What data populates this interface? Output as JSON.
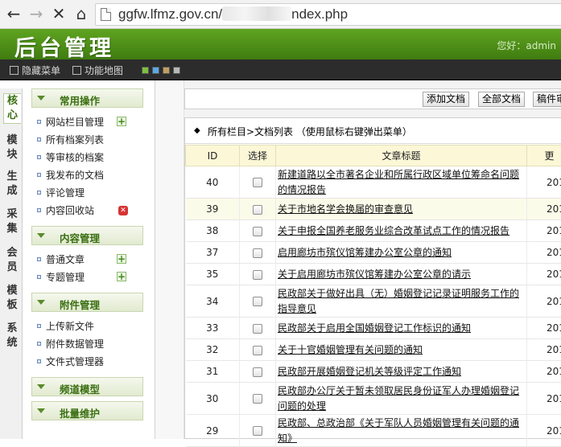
{
  "browser": {
    "url_prefix": "ggfw.lfmz.gov.cn/",
    "url_suffix": "ndex.php"
  },
  "header": {
    "logo": "后台管理",
    "welcome": "您好：admin"
  },
  "menubar": {
    "hide_menu": "隐藏菜单",
    "function_map": "功能地图",
    "swatch_colors": [
      "#7fbf3f",
      "#5aa9e6",
      "#c0a060",
      "#b8b8b8"
    ]
  },
  "sidetabs": [
    "核心",
    "模块",
    "生成",
    "采集",
    "会员",
    "模板",
    "系统"
  ],
  "leftmenu": {
    "groups": [
      {
        "title": "常用操作",
        "items": [
          "网站栏目管理",
          "所有档案列表",
          "等审核的档案",
          "我发布的文档",
          "评论管理",
          "内容回收站"
        ]
      },
      {
        "title": "内容管理",
        "items": [
          "普通文章",
          "专题管理"
        ]
      },
      {
        "title": "附件管理",
        "items": [
          "上传新文件",
          "附件数据管理",
          "文件式管理器"
        ]
      },
      {
        "title": "频道模型",
        "items": []
      },
      {
        "title": "批量维护",
        "items": []
      }
    ]
  },
  "toolbar": {
    "add_doc": "添加文档",
    "all_docs": "全部文档",
    "draft": "稿件审"
  },
  "list": {
    "heading": "所有栏目>文档列表 （使用鼠标右键弹出菜单）",
    "columns": {
      "id": "ID",
      "select": "选择",
      "title": "文章标题",
      "updated": "更"
    },
    "rows": [
      {
        "id": "40",
        "title": "新建道路以全市著名企业和所属行政区域单位筹命名问题的情况报告",
        "date": "201"
      },
      {
        "id": "39",
        "title": "关于市地名学会换届的审查意见",
        "date": "201"
      },
      {
        "id": "38",
        "title": "关于申报全国养老服务业综合改革试点工作的情况报告",
        "date": "201"
      },
      {
        "id": "37",
        "title": "启用廊坊市殡仪馆筹建办公室公章的通知",
        "date": "201"
      },
      {
        "id": "35",
        "title": "关于启用廊坊市殡仪馆筹建办公室公章的请示",
        "date": "201"
      },
      {
        "id": "34",
        "title": "民政部关于做好出具（无）婚姻登记记录证明服务工作的指导意见",
        "date": "201"
      },
      {
        "id": "33",
        "title": "民政部关于启用全国婚姻登记工作标识的通知",
        "date": "201"
      },
      {
        "id": "32",
        "title": "关于十官婚姻管理有关问题的通知",
        "date": "201"
      },
      {
        "id": "31",
        "title": "民政部开展婚姻登记机关等级评定工作通知",
        "date": "201"
      },
      {
        "id": "30",
        "title": "民政部办公厅关于暂未领取居民身份证军人办理婚姻登记问题的处理",
        "date": "201"
      },
      {
        "id": "29",
        "title": "民政部、总政治部《关于军队人员婚姻管理有关问题的通知》",
        "date": "201"
      }
    ]
  }
}
